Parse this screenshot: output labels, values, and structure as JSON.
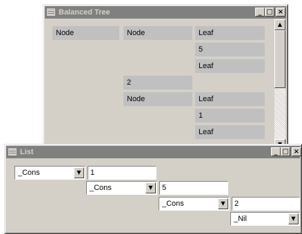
{
  "tree_window": {
    "title": "Balanced Tree",
    "buttons": {
      "minimize": "_",
      "maximize": "□",
      "close": "×"
    },
    "cells": [
      "Node",
      "Node",
      "Leaf",
      "5",
      "Leaf",
      "2",
      "Node",
      "Leaf",
      "1",
      "Leaf"
    ]
  },
  "list_window": {
    "title": "List",
    "buttons": {
      "minimize": "_",
      "maximize": "□",
      "close": "×"
    },
    "rows": [
      {
        "constructor": "_Cons",
        "value": "1"
      },
      {
        "constructor": "_Cons",
        "value": "5"
      },
      {
        "constructor": "_Cons",
        "value": "2"
      },
      {
        "constructor": "_Nil"
      }
    ]
  },
  "icons": {
    "scroll_up": "▲",
    "scroll_down": "▼",
    "dropdown": "▼"
  }
}
